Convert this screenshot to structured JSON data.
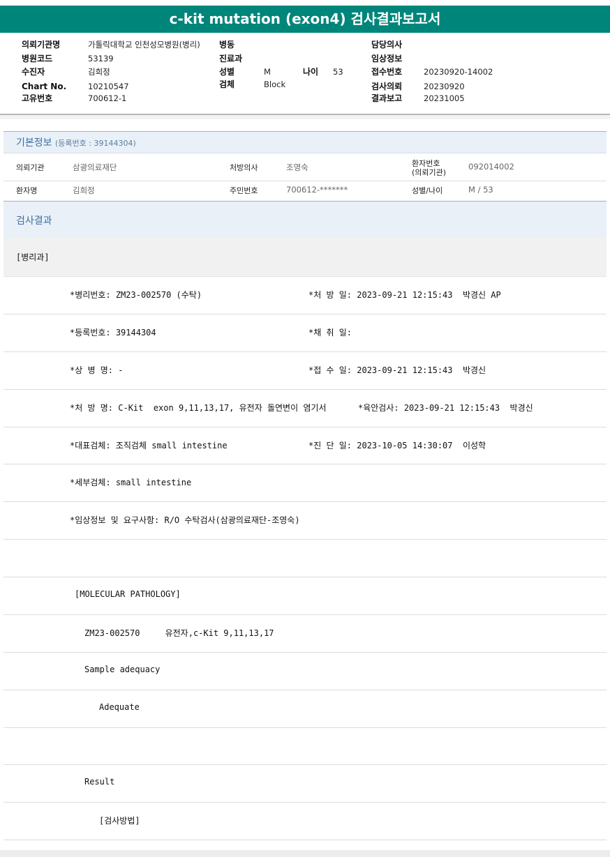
{
  "title": "c-kit mutation (exon4) 검사결과보고서",
  "header": {
    "col1": [
      {
        "label": "의뢰기관명",
        "value": "가톨릭대학교 인천성모병원(병리)"
      },
      {
        "label": "병원코드",
        "value": "53139"
      },
      {
        "label": "수진자",
        "value": "김희정"
      },
      {
        "label": "Chart No.",
        "value": "10210547"
      },
      {
        "label": "고유번호",
        "value": "700612-1"
      }
    ],
    "col2": [
      {
        "label": "병동",
        "value": ""
      },
      {
        "label": "진료과",
        "value": ""
      },
      {
        "label": "성별",
        "value": "M"
      },
      {
        "label": "검체",
        "value": "Block"
      }
    ],
    "age": {
      "label": "나이",
      "value": "53"
    },
    "col3": [
      {
        "label": "담당의사",
        "value": ""
      },
      {
        "label": "임상정보",
        "value": ""
      },
      {
        "label": "접수번호",
        "value": "20230920-14002"
      },
      {
        "label": "검사의뢰",
        "value": "20230920"
      },
      {
        "label": "결과보고",
        "value": "20231005"
      }
    ]
  },
  "basic": {
    "title": "기본정보",
    "sub": "(등록번호 : 39144304)",
    "row1": {
      "inst_label": "의뢰기관",
      "inst_value": "삼광의료재단",
      "doctor_label": "처방의사",
      "doctor_value": "조영숙",
      "pid_label1": "환자번호",
      "pid_label2": "(의뢰기관)",
      "pid_value": "092014002"
    },
    "row2": {
      "name_label": "환자명",
      "name_value": "김희정",
      "rrn_label": "주민번호",
      "rrn_value": "700612-*******",
      "sexage_label": "성별/나이",
      "sexage_value": "M / 53"
    }
  },
  "result": {
    "title": "검사결과",
    "section": "[병리과]",
    "lines": [
      {
        "left": "*병리번호: ZM23-002570 (수탁)",
        "right": "*처 방 일: 2023-09-21 12:15:43  박경신 AP"
      },
      {
        "left": "*등록번호: 39144304",
        "right": "*채 취 일:"
      },
      {
        "left": "*상 병 명: -",
        "right": "*접 수 일: 2023-09-21 12:15:43  박경신"
      },
      {
        "left": "*처 방 명: C-Kit  exon 9,11,13,17, 유전자 돌연변이 염기서",
        "right": "*육안검사: 2023-09-21 12:15:43  박경신"
      },
      {
        "left": "*대표검체: 조직검체 small intestine",
        "right": "*진 단 일: 2023-10-05 14:30:07  이성학"
      },
      {
        "left": "*세부검체: small intestine",
        "right": ""
      },
      {
        "left": "*임상정보 및 요구사항: R/O 수탁검사(삼광의료재단-조영숙)",
        "right": ""
      }
    ],
    "mol_title": "[MOLECULAR PATHOLOGY]",
    "mol_line": "ZM23-002570     유전자,c-Kit 9,11,13,17",
    "sample_label": "Sample adequacy",
    "sample_value": "Adequate",
    "result_label": "Result",
    "method_label": "[검사방법]"
  }
}
